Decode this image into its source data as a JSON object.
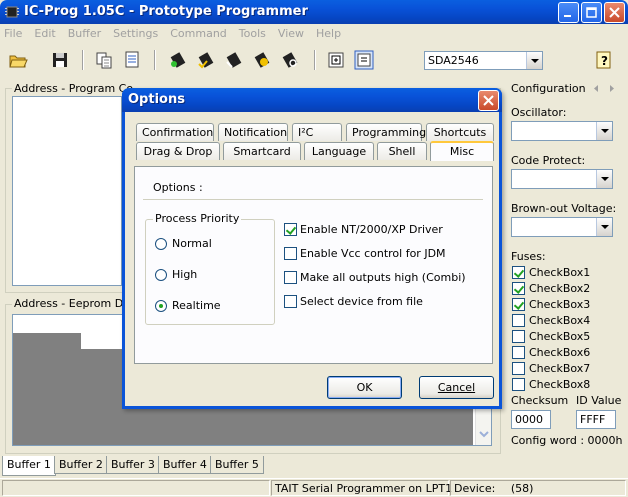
{
  "window": {
    "title": "IC-Prog 1.05C - Prototype Programmer"
  },
  "menu": [
    "File",
    "Edit",
    "Buffer",
    "Settings",
    "Command",
    "Tools",
    "View",
    "Help"
  ],
  "toolbar": {
    "device": "SDA2546"
  },
  "panels": {
    "program_code": "Address - Program Co",
    "eeprom_data": "Address - Eeprom Dat"
  },
  "config": {
    "title": "Configuration",
    "oscillator": "Oscillator:",
    "code_protect": "Code Protect:",
    "brownout": "Brown-out Voltage:",
    "fuses": "Fuses:",
    "checkboxes": [
      {
        "label": "CheckBox1",
        "checked": true
      },
      {
        "label": "CheckBox2",
        "checked": true
      },
      {
        "label": "CheckBox3",
        "checked": true
      },
      {
        "label": "CheckBox4",
        "checked": false
      },
      {
        "label": "CheckBox5",
        "checked": false
      },
      {
        "label": "CheckBox6",
        "checked": false
      },
      {
        "label": "CheckBox7",
        "checked": false
      },
      {
        "label": "CheckBox8",
        "checked": false
      }
    ],
    "checksum_label": "Checksum",
    "id_value_label": "ID Value",
    "checksum_value": "0000",
    "id_value": "FFFF",
    "config_word": "Config word : 0000h"
  },
  "buffers": [
    "Buffer 1",
    "Buffer 2",
    "Buffer 3",
    "Buffer 4",
    "Buffer 5"
  ],
  "status": {
    "programmer": "TAIT  Serial  Programmer on LPT1",
    "device_label": "Device:",
    "device_value": "(58)"
  },
  "dialog": {
    "title": "Options",
    "tabs_row1": [
      "Confirmation",
      "Notification",
      "I²C",
      "Programming",
      "Shortcuts"
    ],
    "tabs_row2": [
      "Drag & Drop",
      "Smartcard",
      "Language",
      "Shell",
      "Misc"
    ],
    "active_tab": "Misc",
    "options_label": "Options :",
    "priority_group": "Process Priority",
    "priorities": [
      {
        "label": "Normal",
        "checked": false
      },
      {
        "label": "High",
        "checked": false
      },
      {
        "label": "Realtime",
        "checked": true
      }
    ],
    "options": [
      {
        "label": "Enable NT/2000/XP Driver",
        "checked": true
      },
      {
        "label": "Enable Vcc control for JDM",
        "checked": false
      },
      {
        "label": "Make all outputs high (Combi)",
        "checked": false
      },
      {
        "label": "Select device from file",
        "checked": false
      }
    ],
    "ok": "OK",
    "cancel": "Cancel"
  }
}
